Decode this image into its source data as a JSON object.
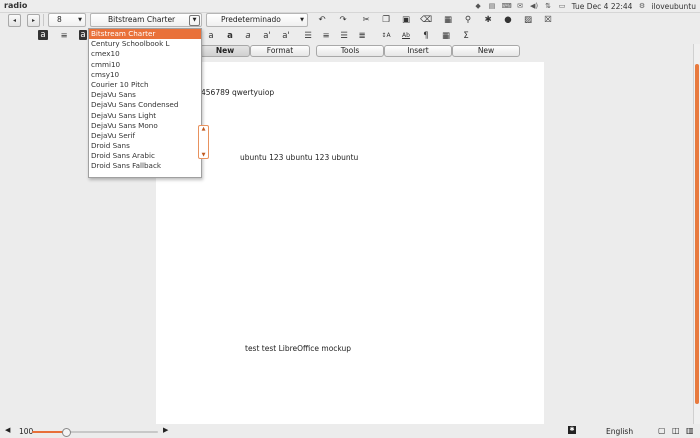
{
  "app": {
    "title": "radio"
  },
  "tray": {
    "clock": "Tue Dec  4  22:44",
    "user": "iloveubuntu"
  },
  "toolbar": {
    "font_size": "8",
    "font_name": "Bitstream Charter",
    "style_name": "Predeterminado",
    "format_labels": {
      "normal": "a",
      "bold": "a",
      "italic": "a",
      "superscript": "a'",
      "subscript": "a'"
    }
  },
  "tabs": [
    {
      "label": "New",
      "active": true
    },
    {
      "label": "Format",
      "active": false
    },
    {
      "label": "Tools",
      "active": false
    },
    {
      "label": "Insert",
      "active": false
    },
    {
      "label": "New",
      "active": false
    }
  ],
  "font_dropdown": {
    "items": [
      {
        "label": "Bitstream Charter",
        "selected": true
      },
      {
        "label": "Century Schoolbook L",
        "selected": false
      },
      {
        "label": "cmex10",
        "selected": false
      },
      {
        "label": "cmmi10",
        "selected": false
      },
      {
        "label": "cmsy10",
        "selected": false
      },
      {
        "label": "Courier 10 Pitch",
        "selected": false
      },
      {
        "label": "DejaVu Sans",
        "selected": false
      },
      {
        "label": "DejaVu Sans Condensed",
        "selected": false
      },
      {
        "label": "DejaVu Sans Light",
        "selected": false
      },
      {
        "label": "DejaVu Sans Mono",
        "selected": false
      },
      {
        "label": "DejaVu Serif",
        "selected": false
      },
      {
        "label": "Droid Sans",
        "selected": false
      },
      {
        "label": "Droid Sans Arabic",
        "selected": false
      },
      {
        "label": "Droid Sans Fallback",
        "selected": false
      }
    ]
  },
  "document": {
    "line1": "456789 qwertyuiop",
    "line2": "ubuntu 123 ubuntu 123 ubuntu",
    "line3": "test test LibreOffice mockup"
  },
  "status": {
    "zoom": "100",
    "zoom_fraction": 0.27,
    "language": "English"
  },
  "colors": {
    "accent": "#e9713a",
    "page": "#ffffff",
    "background": "#ececec"
  }
}
